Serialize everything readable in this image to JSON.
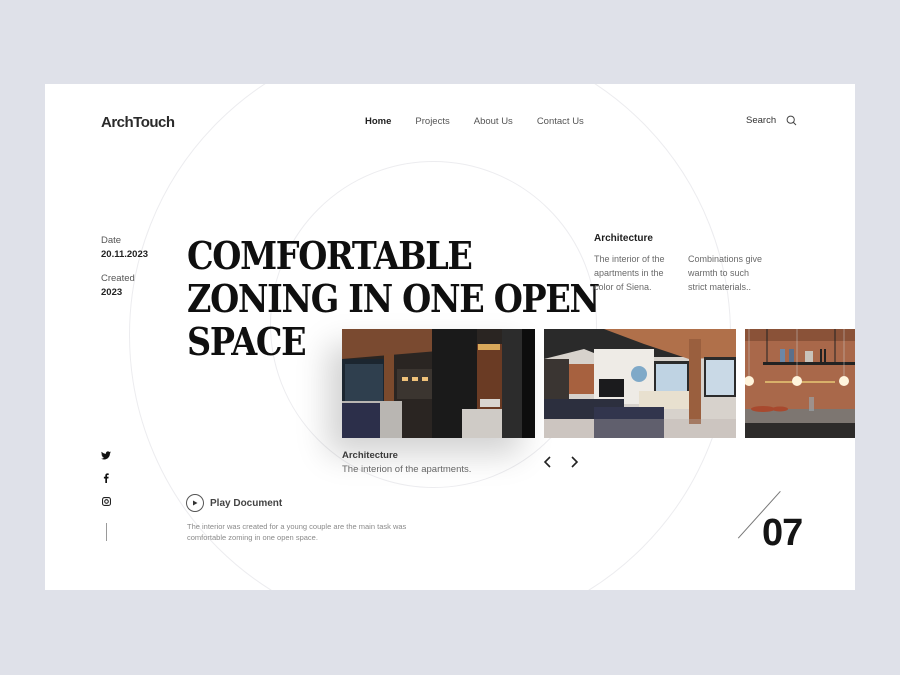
{
  "header": {
    "logo": "ArchTouch",
    "nav": [
      {
        "label": "Home",
        "active": true
      },
      {
        "label": "Projects",
        "active": false
      },
      {
        "label": "About Us",
        "active": false
      },
      {
        "label": "Contact Us",
        "active": false
      }
    ],
    "search_label": "Search",
    "search_icon": "search-icon"
  },
  "meta": {
    "date_label": "Date",
    "date_value": "20.11.2023",
    "created_label": "Created",
    "created_value": "2023"
  },
  "hero": {
    "headline_lines": [
      "COMFORTABLE",
      "ZONING IN ONE OPEN",
      "SPACE"
    ]
  },
  "architecture": {
    "title": "Architecture",
    "col1": "The interior of the apartments in the color of Siena.",
    "col2": "Combinations give warmth to such strict materials.."
  },
  "gallery": {
    "images": [
      {
        "name": "dark-interior-photo",
        "alt": "Dark apartment interior with black partition"
      },
      {
        "name": "living-room-photo",
        "alt": "Open living room with sofa and windows"
      },
      {
        "name": "kitchen-photo",
        "alt": "Kitchen with pendant lights and terracotta wall"
      }
    ],
    "caption_title": "Architecture",
    "caption_subtitle": "The interion of the apartments.",
    "prev_icon": "chevron-left-icon",
    "next_icon": "chevron-right-icon"
  },
  "social": [
    "twitter-icon",
    "facebook-icon",
    "instagram-icon"
  ],
  "play": {
    "label": "Play Document",
    "description": "The interior was created for a young couple are the main task was comfortable zoming in one open space."
  },
  "counter": {
    "value": "07"
  },
  "colors": {
    "background": "#dfe1e9",
    "panel": "#ffffff",
    "text_dark": "#0f0f0f",
    "text_muted": "#6a6a6a"
  }
}
